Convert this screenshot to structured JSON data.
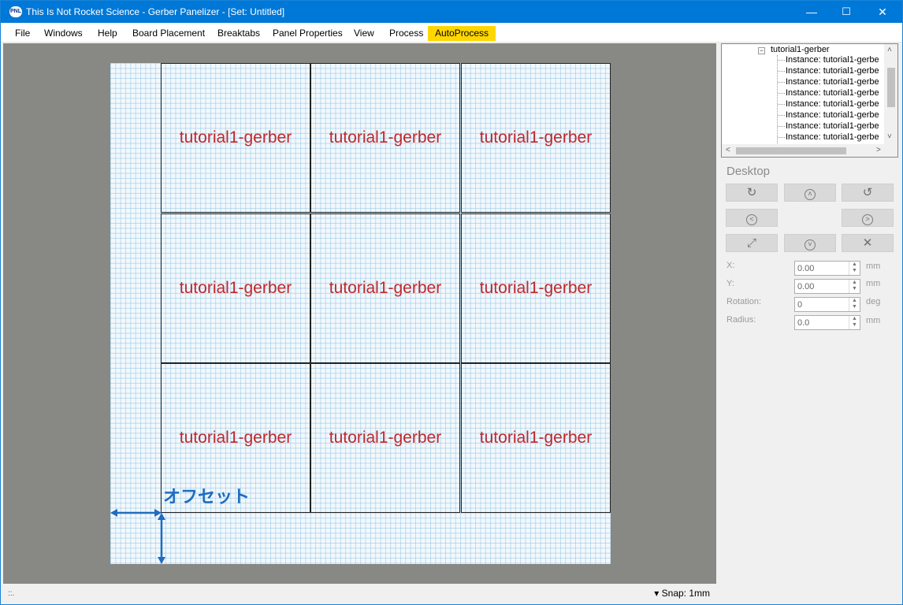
{
  "window": {
    "app_icon_text": "PNL",
    "title": "This Is Not Rocket Science - Gerber Panelizer - [Set: Untitled]",
    "minimize": "—",
    "maximize": "☐",
    "close": "✕"
  },
  "menu": {
    "items": [
      "File",
      "Windows",
      "Help",
      "Board Placement",
      "Breaktabs",
      "Panel Properties",
      "View",
      "Process",
      "AutoProcess"
    ],
    "highlight_color": "#ffd700"
  },
  "canvas": {
    "tiles": [
      "tutorial1-gerber",
      "tutorial1-gerber",
      "tutorial1-gerber",
      "tutorial1-gerber",
      "tutorial1-gerber",
      "tutorial1-gerber",
      "tutorial1-gerber",
      "tutorial1-gerber",
      "tutorial1-gerber"
    ],
    "offset_label": "オフセット",
    "label_color": "#c0282c",
    "annotation_color": "#1f6cc1"
  },
  "tree": {
    "toggle": "−",
    "root": "tutorial1-gerber",
    "leaves": [
      "Instance: tutorial1-gerbe",
      "Instance: tutorial1-gerbe",
      "Instance: tutorial1-gerbe",
      "Instance: tutorial1-gerbe",
      "Instance: tutorial1-gerbe",
      "Instance: tutorial1-gerbe",
      "Instance: tutorial1-gerbe",
      "Instance: tutorial1-gerbe"
    ],
    "scroll_up": "˄",
    "scroll_down": "˅",
    "scroll_left": "<",
    "scroll_right": ">"
  },
  "panel": {
    "title": "Desktop",
    "buttons": {
      "rotate_cw": "↻",
      "up": "˄",
      "rotate_ccw": "↺",
      "left": "<",
      "right": ">",
      "expand": "⤢",
      "down": "˅",
      "contract": "✕"
    },
    "fields": [
      {
        "label": "X:",
        "value": "0.00",
        "unit": "mm"
      },
      {
        "label": "Y:",
        "value": "0.00",
        "unit": "mm"
      },
      {
        "label": "Rotation:",
        "value": "0",
        "unit": "deg"
      },
      {
        "label": "Radius:",
        "value": "0.0",
        "unit": "mm"
      }
    ]
  },
  "statusbar": {
    "grip": "::.",
    "snap_arrow": "▾",
    "snap": "Snap: 1mm"
  }
}
